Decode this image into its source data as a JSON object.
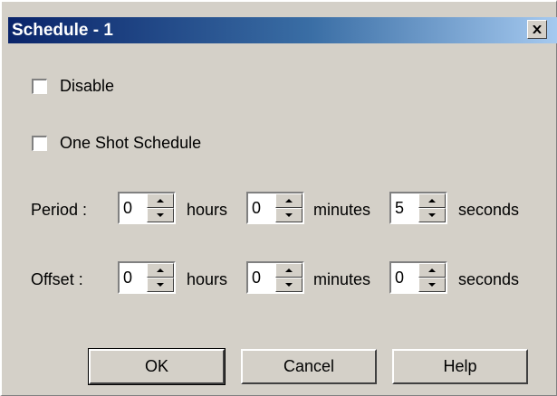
{
  "window": {
    "title": "Schedule - 1",
    "close_icon": "close-icon"
  },
  "options": {
    "disable_label": "Disable",
    "disable_checked": false,
    "one_shot_label": "One Shot Schedule",
    "one_shot_checked": false
  },
  "period": {
    "label": "Period :",
    "hours": "0",
    "hours_unit": "hours",
    "minutes": "0",
    "minutes_unit": "minutes",
    "seconds": "5",
    "seconds_unit": "seconds"
  },
  "offset": {
    "label": "Offset :",
    "hours": "0",
    "hours_unit": "hours",
    "minutes": "0",
    "minutes_unit": "minutes",
    "seconds": "0",
    "seconds_unit": "seconds"
  },
  "buttons": {
    "ok": "OK",
    "cancel": "Cancel",
    "help": "Help"
  },
  "colors": {
    "title_start": "#0a246a",
    "title_end": "#a6caf0",
    "face": "#d4d0c8"
  }
}
